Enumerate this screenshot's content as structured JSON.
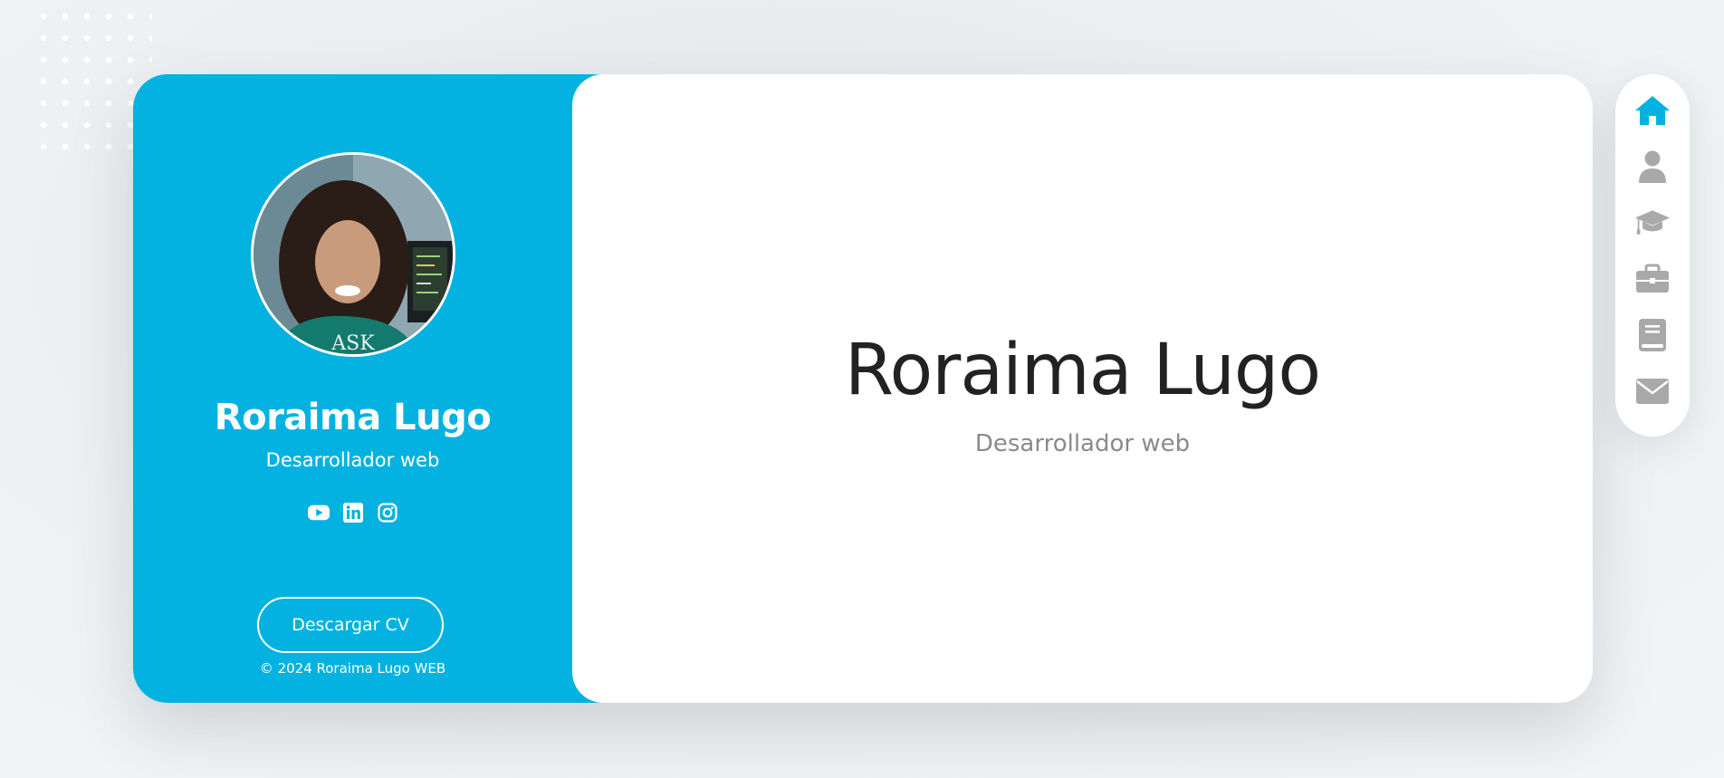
{
  "sidebar": {
    "name": "Roraima Lugo",
    "role": "Desarrollador web",
    "social_icons": [
      "youtube-icon",
      "linkedin-icon",
      "instagram-icon"
    ],
    "download_button": "Descargar CV",
    "copyright": "© 2024 Roraima Lugo WEB"
  },
  "main": {
    "name": "Roraima Lugo",
    "role": "Desarrollador web"
  },
  "nav": {
    "items": [
      "home-icon",
      "user-icon",
      "graduation-cap-icon",
      "briefcase-icon",
      "book-icon",
      "envelope-icon"
    ],
    "active": "home-icon"
  },
  "colors": {
    "accent": "#03b2e0",
    "nav_inactive": "#a9a9a9",
    "heading": "#222222",
    "subtext": "#8a8a8a"
  }
}
